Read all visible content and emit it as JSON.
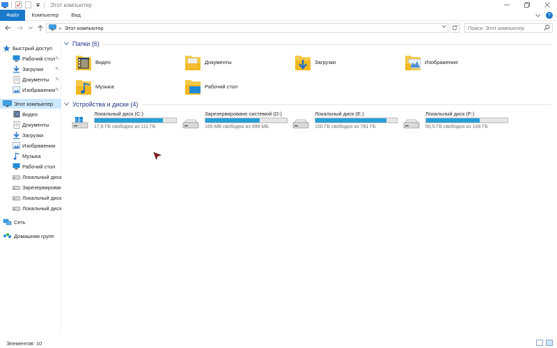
{
  "window": {
    "title": "Этот компьютер",
    "controls": [
      "minimize",
      "maximize",
      "close"
    ]
  },
  "ribbon": {
    "tabs": [
      {
        "label": "Файл",
        "active": true
      },
      {
        "label": "Компьютер"
      },
      {
        "label": "Вид"
      }
    ]
  },
  "address_bar": {
    "location": "Этот компьютер",
    "separator": "»"
  },
  "search": {
    "placeholder": "Поиск: Этот компьютер"
  },
  "sidebar": {
    "quick_access": {
      "label": "Быстрый доступ",
      "items": [
        {
          "label": "Рабочий стол",
          "icon": "desktop-icon"
        },
        {
          "label": "Загрузки",
          "icon": "downloads-icon"
        },
        {
          "label": "Документы",
          "icon": "documents-icon"
        },
        {
          "label": "Изображения",
          "icon": "pictures-icon"
        }
      ]
    },
    "this_pc": {
      "label": "Этот компьютер",
      "items": [
        {
          "label": "Видео",
          "icon": "video-icon"
        },
        {
          "label": "Документы",
          "icon": "documents-icon"
        },
        {
          "label": "Загрузки",
          "icon": "downloads-icon"
        },
        {
          "label": "Изображения",
          "icon": "pictures-icon"
        },
        {
          "label": "Музыка",
          "icon": "music-icon"
        },
        {
          "label": "Рабочий стол",
          "icon": "desktop-icon"
        },
        {
          "label": "Локальный диск",
          "icon": "drive-icon"
        },
        {
          "label": "Зарезервирован",
          "icon": "drive-icon"
        },
        {
          "label": "Локальный диск",
          "icon": "drive-icon"
        },
        {
          "label": "Локальный диск",
          "icon": "drive-icon"
        }
      ]
    },
    "network": {
      "label": "Сеть"
    },
    "homegroup": {
      "label": "Домашняя групп"
    }
  },
  "folders_group": {
    "label": "Папки (6)",
    "items": [
      {
        "label": "Видео",
        "icon": "video-folder-icon"
      },
      {
        "label": "Документы",
        "icon": "documents-folder-icon"
      },
      {
        "label": "Загрузки",
        "icon": "downloads-folder-icon"
      },
      {
        "label": "Изображения",
        "icon": "pictures-folder-icon"
      },
      {
        "label": "Музыка",
        "icon": "music-folder-icon"
      },
      {
        "label": "Рабочий стол",
        "icon": "desktop-folder-icon"
      }
    ]
  },
  "drives_group": {
    "label": "Устройства и диски (4)",
    "items": [
      {
        "label": "Локальный диск (C:)",
        "free": "17,6 ГБ свободно из 111 ГБ",
        "used_fraction": 0.84,
        "icon": "windows-drive-icon"
      },
      {
        "label": "Зарезервировано системой (D:)",
        "free": "165 МБ свободно из 499 МБ",
        "used_fraction": 0.67,
        "icon": "drive-icon"
      },
      {
        "label": "Локальный диск (E:)",
        "free": "100 ГБ свободно из 781 ГБ",
        "used_fraction": 0.87,
        "icon": "drive-icon"
      },
      {
        "label": "Локальный диск (F:)",
        "free": "50,5 ГБ свободно из 149 ГБ",
        "used_fraction": 0.66,
        "icon": "drive-icon"
      }
    ]
  },
  "status": {
    "count": "Элементов: 10"
  },
  "colors": {
    "accent": "#1979ca",
    "bar_fill": "#26a0da",
    "selected": "#cce8ff",
    "group_heading": "#1e3287",
    "folder_yellow": "#f6c94a"
  }
}
